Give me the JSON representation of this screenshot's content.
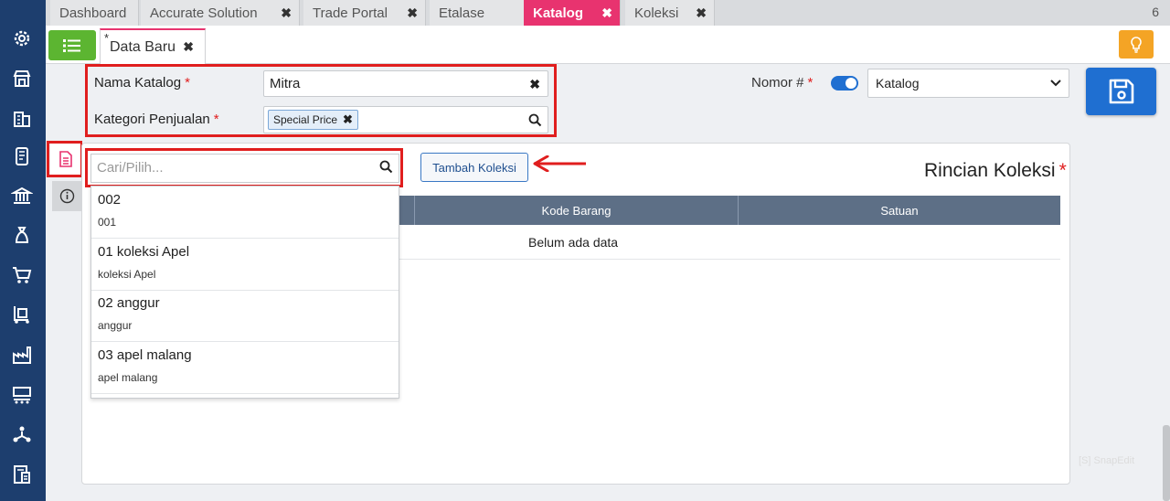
{
  "top_tabs": [
    {
      "label": "Dashboard",
      "closable": false,
      "active": false
    },
    {
      "label": "Accurate Solution",
      "closable": true,
      "active": false
    },
    {
      "label": "Trade Portal",
      "closable": true,
      "active": false
    },
    {
      "label": "Etalase",
      "closable": true,
      "active": false
    },
    {
      "label": "Katalog",
      "closable": true,
      "active": true
    },
    {
      "label": "Koleksi",
      "closable": true,
      "active": false
    }
  ],
  "tab_count": "6",
  "close_glyph": "✖",
  "doc_tab": {
    "modified_mark": "*",
    "label": "Data Baru"
  },
  "form": {
    "nama_label": "Nama Katalog",
    "nama_value": "Mitra",
    "kategori_label": "Kategori Penjualan",
    "kategori_chip": "Special Price",
    "required_mark": "*",
    "nomor_label": "Nomor #",
    "nomor_select_value": "Katalog"
  },
  "collection": {
    "search_placeholder": "Cari/Pilih...",
    "add_button": "Tambah Koleksi",
    "title": "Rincian Koleksi",
    "columns": [
      "Kode Barang",
      "Satuan"
    ],
    "empty_text": "Belum ada data",
    "dropdown_items": [
      {
        "title": "002",
        "subtitle": "001"
      },
      {
        "title": "01 koleksi Apel",
        "subtitle": "koleksi Apel"
      },
      {
        "title": "02 anggur",
        "subtitle": "anggur"
      },
      {
        "title": "03 apel malang",
        "subtitle": "apel malang"
      }
    ]
  },
  "watermark": "[S] SnapEdit",
  "colors": {
    "accent_pink": "#e8336f",
    "sidebar": "#1d3e6e",
    "primary_blue": "#1f6fd1",
    "highlight_red": "#e01e1e",
    "green": "#5cb531",
    "orange": "#f4a425"
  },
  "sidebar_icons": [
    "gear-icon",
    "shop-icon",
    "building-icon",
    "phone-book-icon",
    "bank-icon",
    "money-bag-icon",
    "cart-icon",
    "trolley-icon",
    "factory-icon",
    "conveyor-icon",
    "people-network-icon",
    "tax-report-icon"
  ]
}
